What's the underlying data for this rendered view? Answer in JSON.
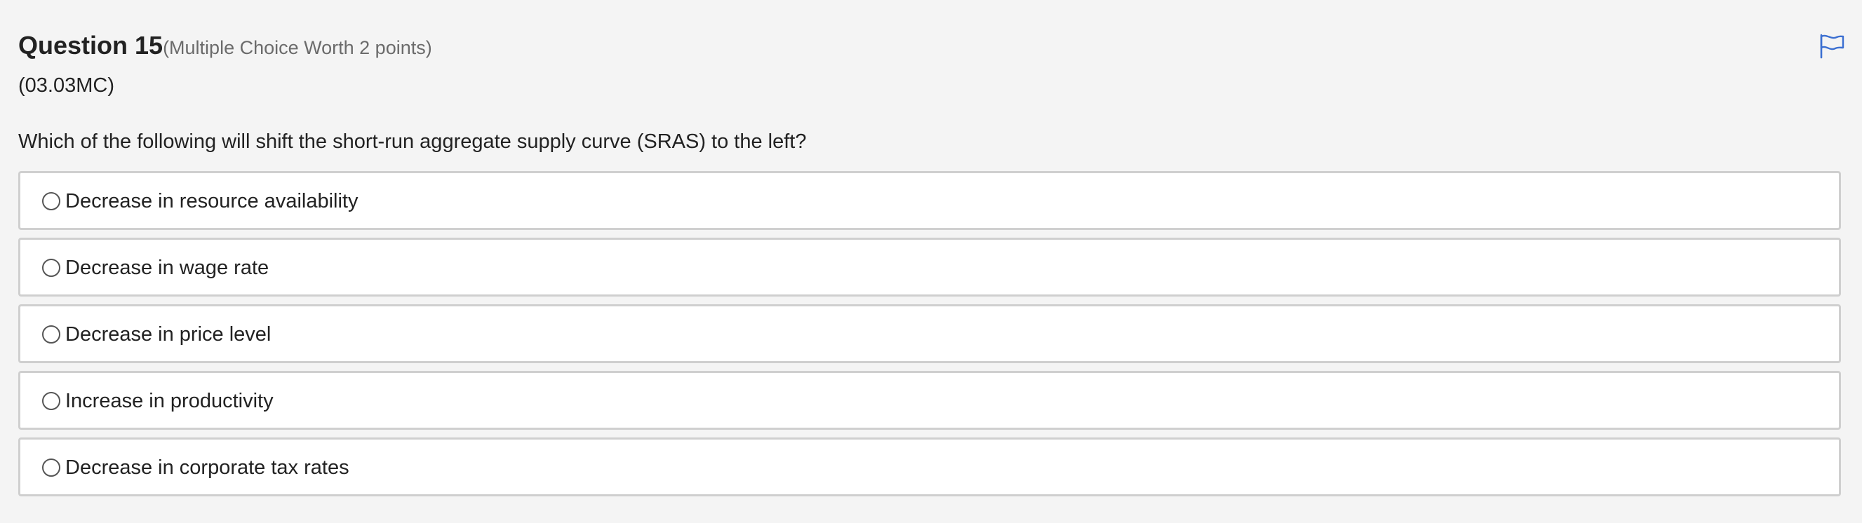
{
  "question": {
    "title": "Question 15",
    "meta": "(Multiple Choice Worth 2 points)",
    "code": "(03.03MC)",
    "prompt": "Which of the following will shift the short-run aggregate supply curve (SRAS) to the left?",
    "flag_icon": "flag-icon"
  },
  "options": [
    {
      "label": "Decrease in resource availability",
      "selected": false
    },
    {
      "label": "Decrease in wage rate",
      "selected": false
    },
    {
      "label": "Decrease in price level",
      "selected": false
    },
    {
      "label": "Increase in productivity",
      "selected": false
    },
    {
      "label": "Decrease in corporate tax rates",
      "selected": false
    }
  ],
  "colors": {
    "background": "#f4f4f4",
    "flag": "#3b6fd1",
    "option_border": "#cfcfcf",
    "meta_text": "#6b6b6b"
  }
}
